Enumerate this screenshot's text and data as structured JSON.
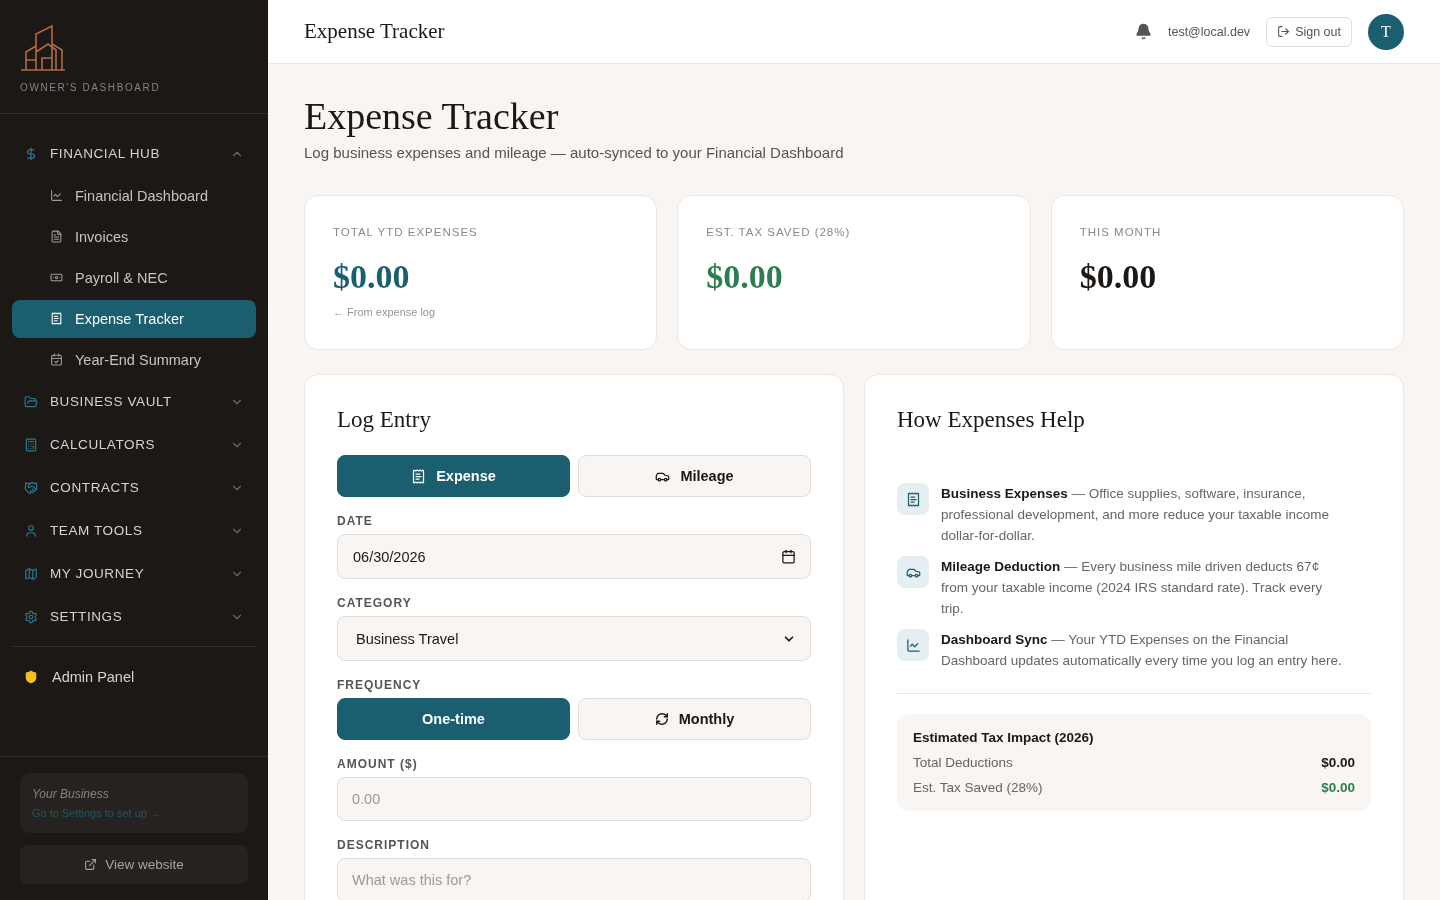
{
  "sidebar": {
    "brand": "OWNER'S DASHBOARD",
    "groups": [
      {
        "label": "FINANCIAL HUB",
        "expanded": true,
        "children": [
          {
            "label": "Financial Dashboard",
            "selected": false
          },
          {
            "label": "Invoices",
            "selected": false
          },
          {
            "label": "Payroll & NEC",
            "selected": false
          },
          {
            "label": "Expense Tracker",
            "selected": true
          },
          {
            "label": "Year-End Summary",
            "selected": false
          }
        ]
      },
      {
        "label": "BUSINESS VAULT",
        "expanded": false
      },
      {
        "label": "CALCULATORS",
        "expanded": false
      },
      {
        "label": "CONTRACTS",
        "expanded": false
      },
      {
        "label": "TEAM TOOLS",
        "expanded": false
      },
      {
        "label": "MY JOURNEY",
        "expanded": false
      },
      {
        "label": "SETTINGS",
        "expanded": false
      }
    ],
    "admin": "Admin Panel",
    "business": {
      "title": "Your Business",
      "link": "Go to Settings to set up →"
    },
    "view_website": "View website"
  },
  "topbar": {
    "title": "Expense Tracker",
    "email": "test@local.dev",
    "sign_out": "Sign out",
    "avatar": "T"
  },
  "page": {
    "title": "Expense Tracker",
    "subtitle": "Log business expenses and mileage — auto-synced to your Financial Dashboard"
  },
  "stats": [
    {
      "label": "TOTAL YTD EXPENSES",
      "value": "$0.00",
      "color": "#1b5e70",
      "note": "← From expense log"
    },
    {
      "label": "EST. TAX SAVED (28%)",
      "value": "$0.00",
      "color": "#2e7d4f"
    },
    {
      "label": "THIS MONTH",
      "value": "$0.00",
      "color": "#1c1816"
    }
  ],
  "log_entry": {
    "title": "Log Entry",
    "entry_types": [
      {
        "label": "Expense",
        "selected": true
      },
      {
        "label": "Mileage",
        "selected": false
      }
    ],
    "date": {
      "label": "DATE",
      "value": "06/30/2026"
    },
    "category": {
      "label": "CATEGORY",
      "value": "Business Travel"
    },
    "frequency": {
      "label": "FREQUENCY",
      "options": [
        {
          "label": "One-time",
          "selected": true
        },
        {
          "label": "Monthly",
          "selected": false
        }
      ]
    },
    "amount": {
      "label": "AMOUNT ($)",
      "placeholder": "0.00"
    },
    "description": {
      "label": "DESCRIPTION",
      "placeholder": "What was this for?"
    }
  },
  "help": {
    "title": "How Expenses Help",
    "items": [
      "**Business Expenses** — Office supplies, software, insurance, professional development, and more reduce your taxable income dollar-for-dollar.",
      "**Mileage Deduction** — Every business mile driven deducts 67¢ from your taxable income (2024 IRS standard rate). Track every trip.",
      "**Dashboard Sync** — Your YTD Expenses on the Financial Dashboard updates automatically every time you log an entry here."
    ],
    "impact": {
      "title": "Estimated Tax Impact (2026)",
      "rows": [
        {
          "label": "Total Deductions",
          "value": "$0.00",
          "color": "#1c1816"
        },
        {
          "label": "Est. Tax Saved (28%)",
          "value": "$0.00",
          "color": "#2e7d4f"
        }
      ]
    }
  }
}
